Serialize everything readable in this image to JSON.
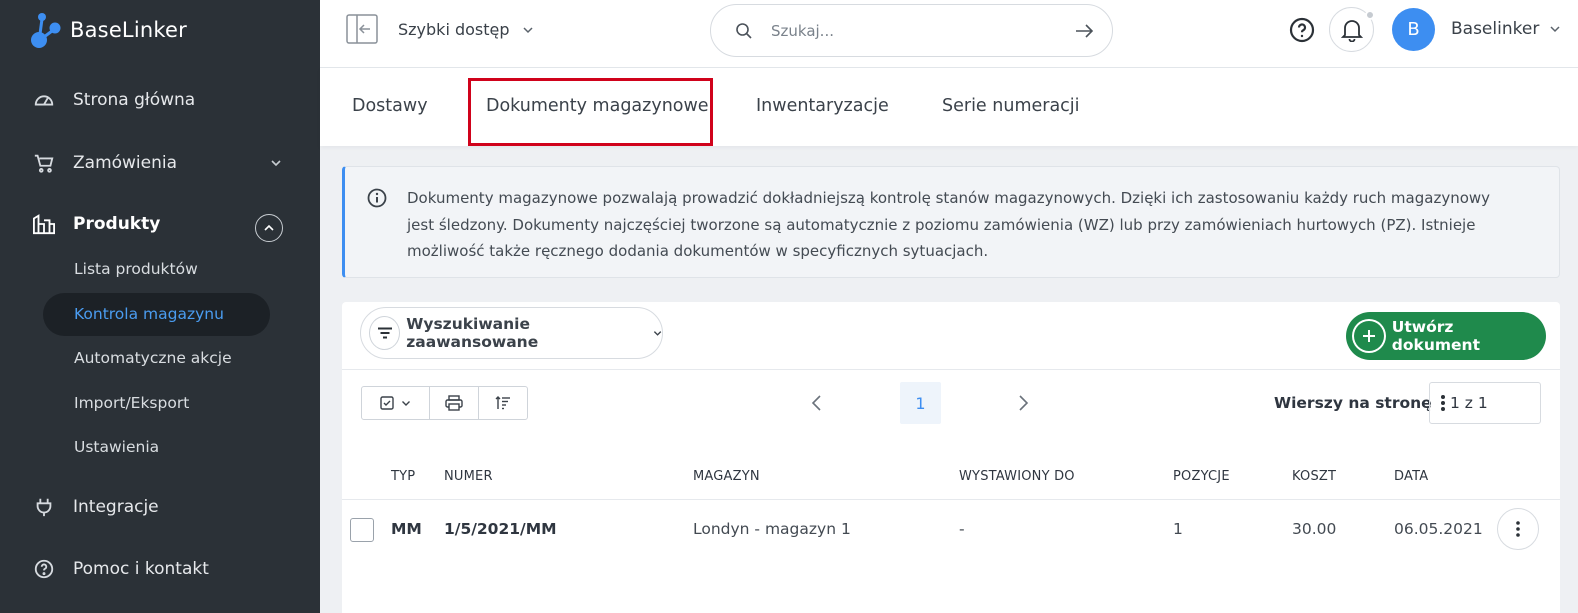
{
  "app": {
    "name": "BaseLinker"
  },
  "colors": {
    "sidebar_bg": "#2b3137",
    "accent_blue": "#3d8ef1",
    "create_green": "#1f8a4c",
    "highlight_red": "#d0021b"
  },
  "sidebar": {
    "items": [
      {
        "label": "Strona główna",
        "icon": "dashboard-icon"
      },
      {
        "label": "Zamówienia",
        "icon": "cart-icon"
      },
      {
        "label": "Produkty",
        "icon": "warehouse-icon"
      },
      {
        "label": "Integracje",
        "icon": "plug-icon"
      },
      {
        "label": "Pomoc i kontakt",
        "icon": "help-icon"
      }
    ],
    "sub_items": [
      {
        "label": "Lista produktów"
      },
      {
        "label": "Kontrola magazynu"
      },
      {
        "label": "Automatyczne akcje"
      },
      {
        "label": "Import/Eksport"
      },
      {
        "label": "Ustawienia"
      }
    ]
  },
  "topbar": {
    "quick_access": "Szybki dostęp",
    "search_placeholder": "Szukaj...",
    "avatar_letter": "B",
    "user_name": "Baselinker"
  },
  "tabs": [
    {
      "label": "Dostawy"
    },
    {
      "label": "Dokumenty magazynowe"
    },
    {
      "label": "Inwentaryzacje"
    },
    {
      "label": "Serie numeracji"
    }
  ],
  "info": {
    "text": "Dokumenty magazynowe pozwalają prowadzić dokładniejszą kontrolę stanów magazynowych. Dzięki ich zastosowaniu każdy ruch magazynowy jest śledzony. Dokumenty najczęściej tworzone są automatycznie z poziomu zamówienia (WZ) lub przy zamówieniach hurtowych (PZ). Istnieje możliwość także ręcznego dodania dokumentów w specyficznych sytuacjach."
  },
  "toolbar": {
    "advanced_search": "Wyszukiwanie zaawansowane",
    "create_document": "Utwórz dokument",
    "page": "1",
    "rows_label": "Wierszy na stronę",
    "rows_value": "1 z 1"
  },
  "table": {
    "headers": [
      "TYP",
      "NUMER",
      "MAGAZYN",
      "WYSTAWIONY DO",
      "POZYCJE",
      "KOSZT",
      "DATA"
    ],
    "rows": [
      [
        "MM",
        "1/5/2021/MM",
        "Londyn - magazyn 1",
        "-",
        "1",
        "30.00",
        "06.05.2021"
      ]
    ]
  }
}
